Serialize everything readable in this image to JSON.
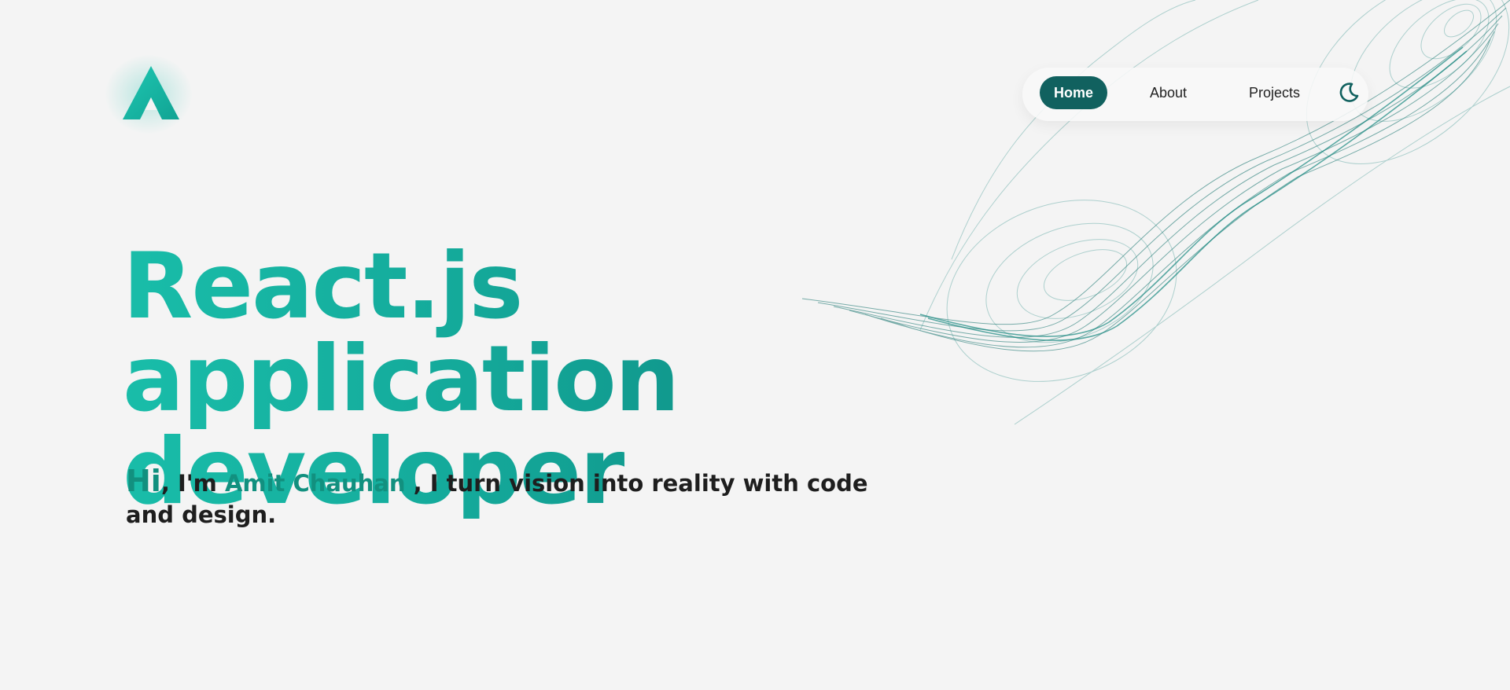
{
  "header": {
    "logo_icon": "a-logo-icon"
  },
  "nav": {
    "items": [
      {
        "label": "Home",
        "active": true
      },
      {
        "label": "About",
        "active": false
      },
      {
        "label": "Projects",
        "active": false
      }
    ],
    "theme_toggle_icon": "moon-icon"
  },
  "hero": {
    "headline_line1": "React.js application",
    "headline_line2": "developer",
    "intro": {
      "hi": "Hi",
      "prefix": ", I'm ",
      "name": "Amit Chauhan",
      "suffix": " , I turn vision into reality with code and design."
    }
  },
  "colors": {
    "background": "#f4f4f4",
    "accent": "#12907f",
    "accent_light": "#19bda9",
    "accent_dark": "#11615f",
    "text": "#1e1e1e"
  }
}
